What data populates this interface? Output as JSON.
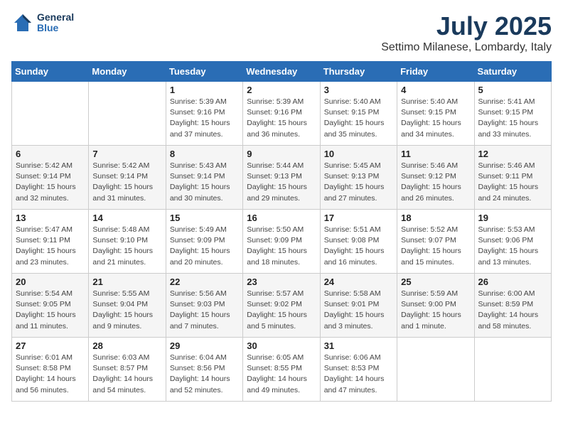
{
  "header": {
    "logo_line1": "General",
    "logo_line2": "Blue",
    "month": "July 2025",
    "location": "Settimo Milanese, Lombardy, Italy"
  },
  "weekdays": [
    "Sunday",
    "Monday",
    "Tuesday",
    "Wednesday",
    "Thursday",
    "Friday",
    "Saturday"
  ],
  "weeks": [
    [
      {
        "day": "",
        "sunrise": "",
        "sunset": "",
        "daylight": ""
      },
      {
        "day": "",
        "sunrise": "",
        "sunset": "",
        "daylight": ""
      },
      {
        "day": "1",
        "sunrise": "Sunrise: 5:39 AM",
        "sunset": "Sunset: 9:16 PM",
        "daylight": "Daylight: 15 hours and 37 minutes."
      },
      {
        "day": "2",
        "sunrise": "Sunrise: 5:39 AM",
        "sunset": "Sunset: 9:16 PM",
        "daylight": "Daylight: 15 hours and 36 minutes."
      },
      {
        "day": "3",
        "sunrise": "Sunrise: 5:40 AM",
        "sunset": "Sunset: 9:15 PM",
        "daylight": "Daylight: 15 hours and 35 minutes."
      },
      {
        "day": "4",
        "sunrise": "Sunrise: 5:40 AM",
        "sunset": "Sunset: 9:15 PM",
        "daylight": "Daylight: 15 hours and 34 minutes."
      },
      {
        "day": "5",
        "sunrise": "Sunrise: 5:41 AM",
        "sunset": "Sunset: 9:15 PM",
        "daylight": "Daylight: 15 hours and 33 minutes."
      }
    ],
    [
      {
        "day": "6",
        "sunrise": "Sunrise: 5:42 AM",
        "sunset": "Sunset: 9:14 PM",
        "daylight": "Daylight: 15 hours and 32 minutes."
      },
      {
        "day": "7",
        "sunrise": "Sunrise: 5:42 AM",
        "sunset": "Sunset: 9:14 PM",
        "daylight": "Daylight: 15 hours and 31 minutes."
      },
      {
        "day": "8",
        "sunrise": "Sunrise: 5:43 AM",
        "sunset": "Sunset: 9:14 PM",
        "daylight": "Daylight: 15 hours and 30 minutes."
      },
      {
        "day": "9",
        "sunrise": "Sunrise: 5:44 AM",
        "sunset": "Sunset: 9:13 PM",
        "daylight": "Daylight: 15 hours and 29 minutes."
      },
      {
        "day": "10",
        "sunrise": "Sunrise: 5:45 AM",
        "sunset": "Sunset: 9:13 PM",
        "daylight": "Daylight: 15 hours and 27 minutes."
      },
      {
        "day": "11",
        "sunrise": "Sunrise: 5:46 AM",
        "sunset": "Sunset: 9:12 PM",
        "daylight": "Daylight: 15 hours and 26 minutes."
      },
      {
        "day": "12",
        "sunrise": "Sunrise: 5:46 AM",
        "sunset": "Sunset: 9:11 PM",
        "daylight": "Daylight: 15 hours and 24 minutes."
      }
    ],
    [
      {
        "day": "13",
        "sunrise": "Sunrise: 5:47 AM",
        "sunset": "Sunset: 9:11 PM",
        "daylight": "Daylight: 15 hours and 23 minutes."
      },
      {
        "day": "14",
        "sunrise": "Sunrise: 5:48 AM",
        "sunset": "Sunset: 9:10 PM",
        "daylight": "Daylight: 15 hours and 21 minutes."
      },
      {
        "day": "15",
        "sunrise": "Sunrise: 5:49 AM",
        "sunset": "Sunset: 9:09 PM",
        "daylight": "Daylight: 15 hours and 20 minutes."
      },
      {
        "day": "16",
        "sunrise": "Sunrise: 5:50 AM",
        "sunset": "Sunset: 9:09 PM",
        "daylight": "Daylight: 15 hours and 18 minutes."
      },
      {
        "day": "17",
        "sunrise": "Sunrise: 5:51 AM",
        "sunset": "Sunset: 9:08 PM",
        "daylight": "Daylight: 15 hours and 16 minutes."
      },
      {
        "day": "18",
        "sunrise": "Sunrise: 5:52 AM",
        "sunset": "Sunset: 9:07 PM",
        "daylight": "Daylight: 15 hours and 15 minutes."
      },
      {
        "day": "19",
        "sunrise": "Sunrise: 5:53 AM",
        "sunset": "Sunset: 9:06 PM",
        "daylight": "Daylight: 15 hours and 13 minutes."
      }
    ],
    [
      {
        "day": "20",
        "sunrise": "Sunrise: 5:54 AM",
        "sunset": "Sunset: 9:05 PM",
        "daylight": "Daylight: 15 hours and 11 minutes."
      },
      {
        "day": "21",
        "sunrise": "Sunrise: 5:55 AM",
        "sunset": "Sunset: 9:04 PM",
        "daylight": "Daylight: 15 hours and 9 minutes."
      },
      {
        "day": "22",
        "sunrise": "Sunrise: 5:56 AM",
        "sunset": "Sunset: 9:03 PM",
        "daylight": "Daylight: 15 hours and 7 minutes."
      },
      {
        "day": "23",
        "sunrise": "Sunrise: 5:57 AM",
        "sunset": "Sunset: 9:02 PM",
        "daylight": "Daylight: 15 hours and 5 minutes."
      },
      {
        "day": "24",
        "sunrise": "Sunrise: 5:58 AM",
        "sunset": "Sunset: 9:01 PM",
        "daylight": "Daylight: 15 hours and 3 minutes."
      },
      {
        "day": "25",
        "sunrise": "Sunrise: 5:59 AM",
        "sunset": "Sunset: 9:00 PM",
        "daylight": "Daylight: 15 hours and 1 minute."
      },
      {
        "day": "26",
        "sunrise": "Sunrise: 6:00 AM",
        "sunset": "Sunset: 8:59 PM",
        "daylight": "Daylight: 14 hours and 58 minutes."
      }
    ],
    [
      {
        "day": "27",
        "sunrise": "Sunrise: 6:01 AM",
        "sunset": "Sunset: 8:58 PM",
        "daylight": "Daylight: 14 hours and 56 minutes."
      },
      {
        "day": "28",
        "sunrise": "Sunrise: 6:03 AM",
        "sunset": "Sunset: 8:57 PM",
        "daylight": "Daylight: 14 hours and 54 minutes."
      },
      {
        "day": "29",
        "sunrise": "Sunrise: 6:04 AM",
        "sunset": "Sunset: 8:56 PM",
        "daylight": "Daylight: 14 hours and 52 minutes."
      },
      {
        "day": "30",
        "sunrise": "Sunrise: 6:05 AM",
        "sunset": "Sunset: 8:55 PM",
        "daylight": "Daylight: 14 hours and 49 minutes."
      },
      {
        "day": "31",
        "sunrise": "Sunrise: 6:06 AM",
        "sunset": "Sunset: 8:53 PM",
        "daylight": "Daylight: 14 hours and 47 minutes."
      },
      {
        "day": "",
        "sunrise": "",
        "sunset": "",
        "daylight": ""
      },
      {
        "day": "",
        "sunrise": "",
        "sunset": "",
        "daylight": ""
      }
    ]
  ]
}
